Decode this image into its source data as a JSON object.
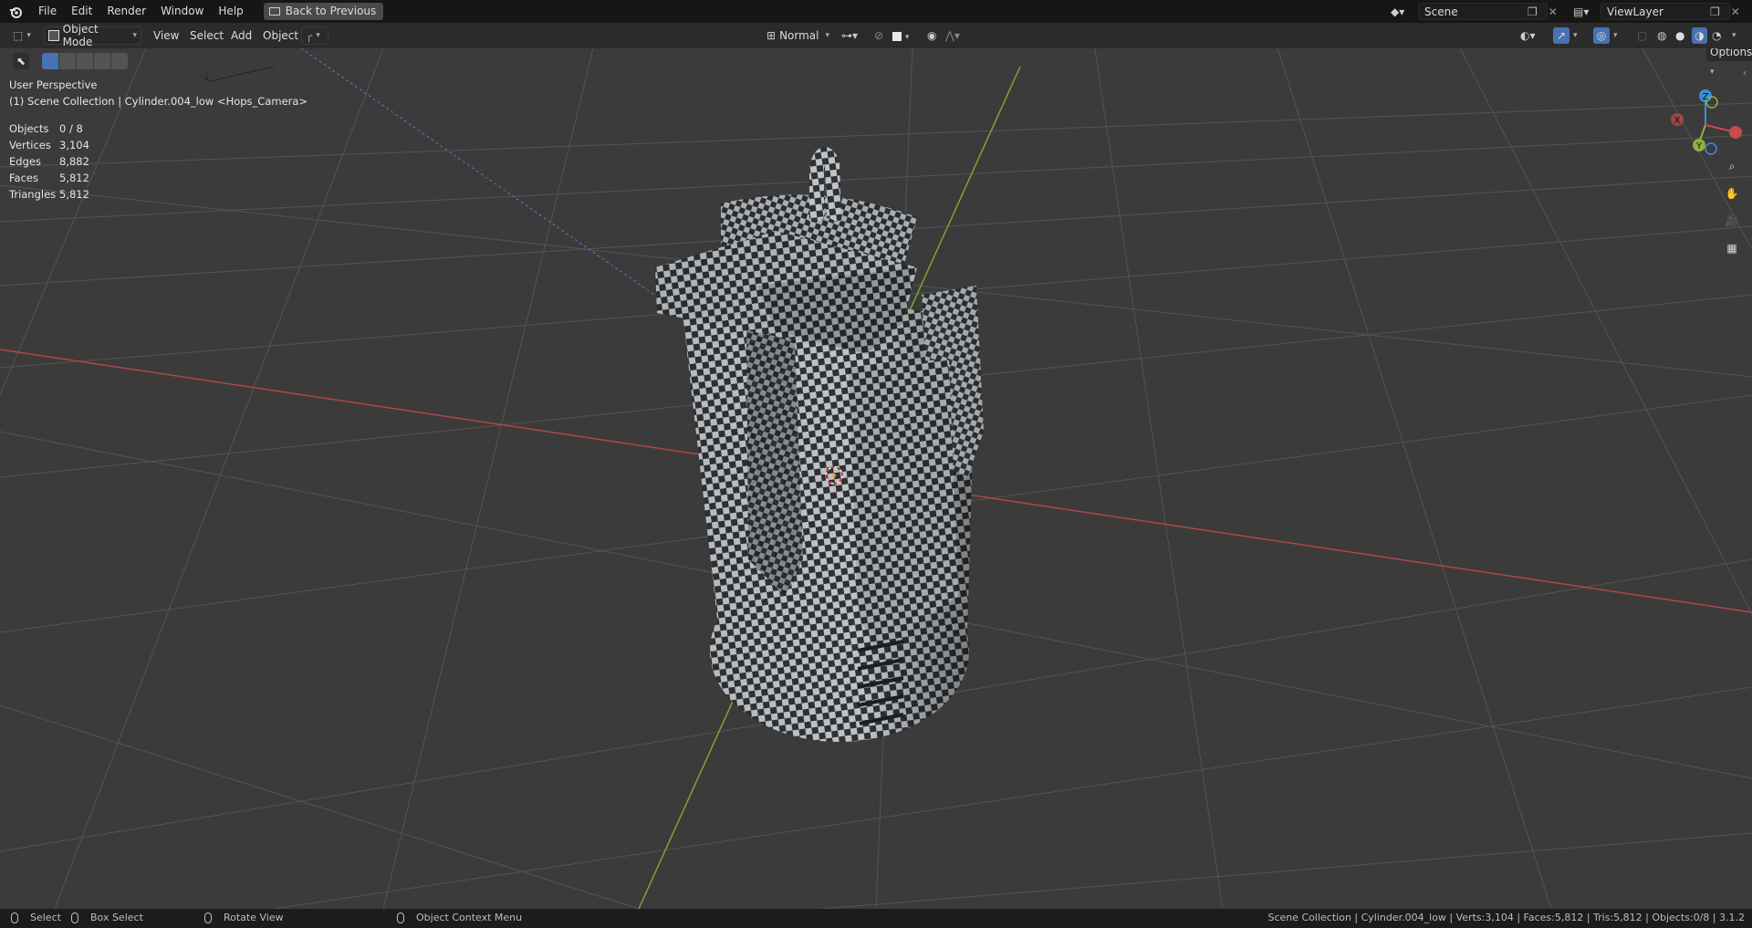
{
  "menubar": {
    "items": [
      "File",
      "Edit",
      "Render",
      "Window",
      "Help"
    ],
    "back_button": "Back to Previous",
    "scene_value": "Scene",
    "viewlayer_value": "ViewLayer"
  },
  "header": {
    "mode": "Object Mode",
    "menus": [
      "View",
      "Select",
      "Add",
      "Object"
    ],
    "orientation": "Normal",
    "options": "Options"
  },
  "viewport": {
    "perspective": "User Perspective",
    "collection": "(1) Scene Collection | Cylinder.004_low <Hops_Camera>",
    "stats": [
      {
        "label": "Objects",
        "value": "0 / 8"
      },
      {
        "label": "Vertices",
        "value": "3,104"
      },
      {
        "label": "Edges",
        "value": "8,882"
      },
      {
        "label": "Faces",
        "value": "5,812"
      },
      {
        "label": "Triangles",
        "value": "5,812"
      }
    ],
    "gizmo": {
      "z": "Z",
      "y": "Y",
      "x": "X"
    }
  },
  "statusbar": {
    "select": "Select",
    "box_select": "Box Select",
    "rotate_view": "Rotate View",
    "context_menu": "Object Context Menu",
    "info": "Scene Collection | Cylinder.004_low | Verts:3,104 | Faces:5,812 | Tris:5,812 | Objects:0/8 | 3.1.2"
  },
  "colors": {
    "x_axis": "#c94a4a",
    "y_axis": "#8db33a",
    "z_axis": "#3a8fd8",
    "active_button": "#4772b3"
  }
}
